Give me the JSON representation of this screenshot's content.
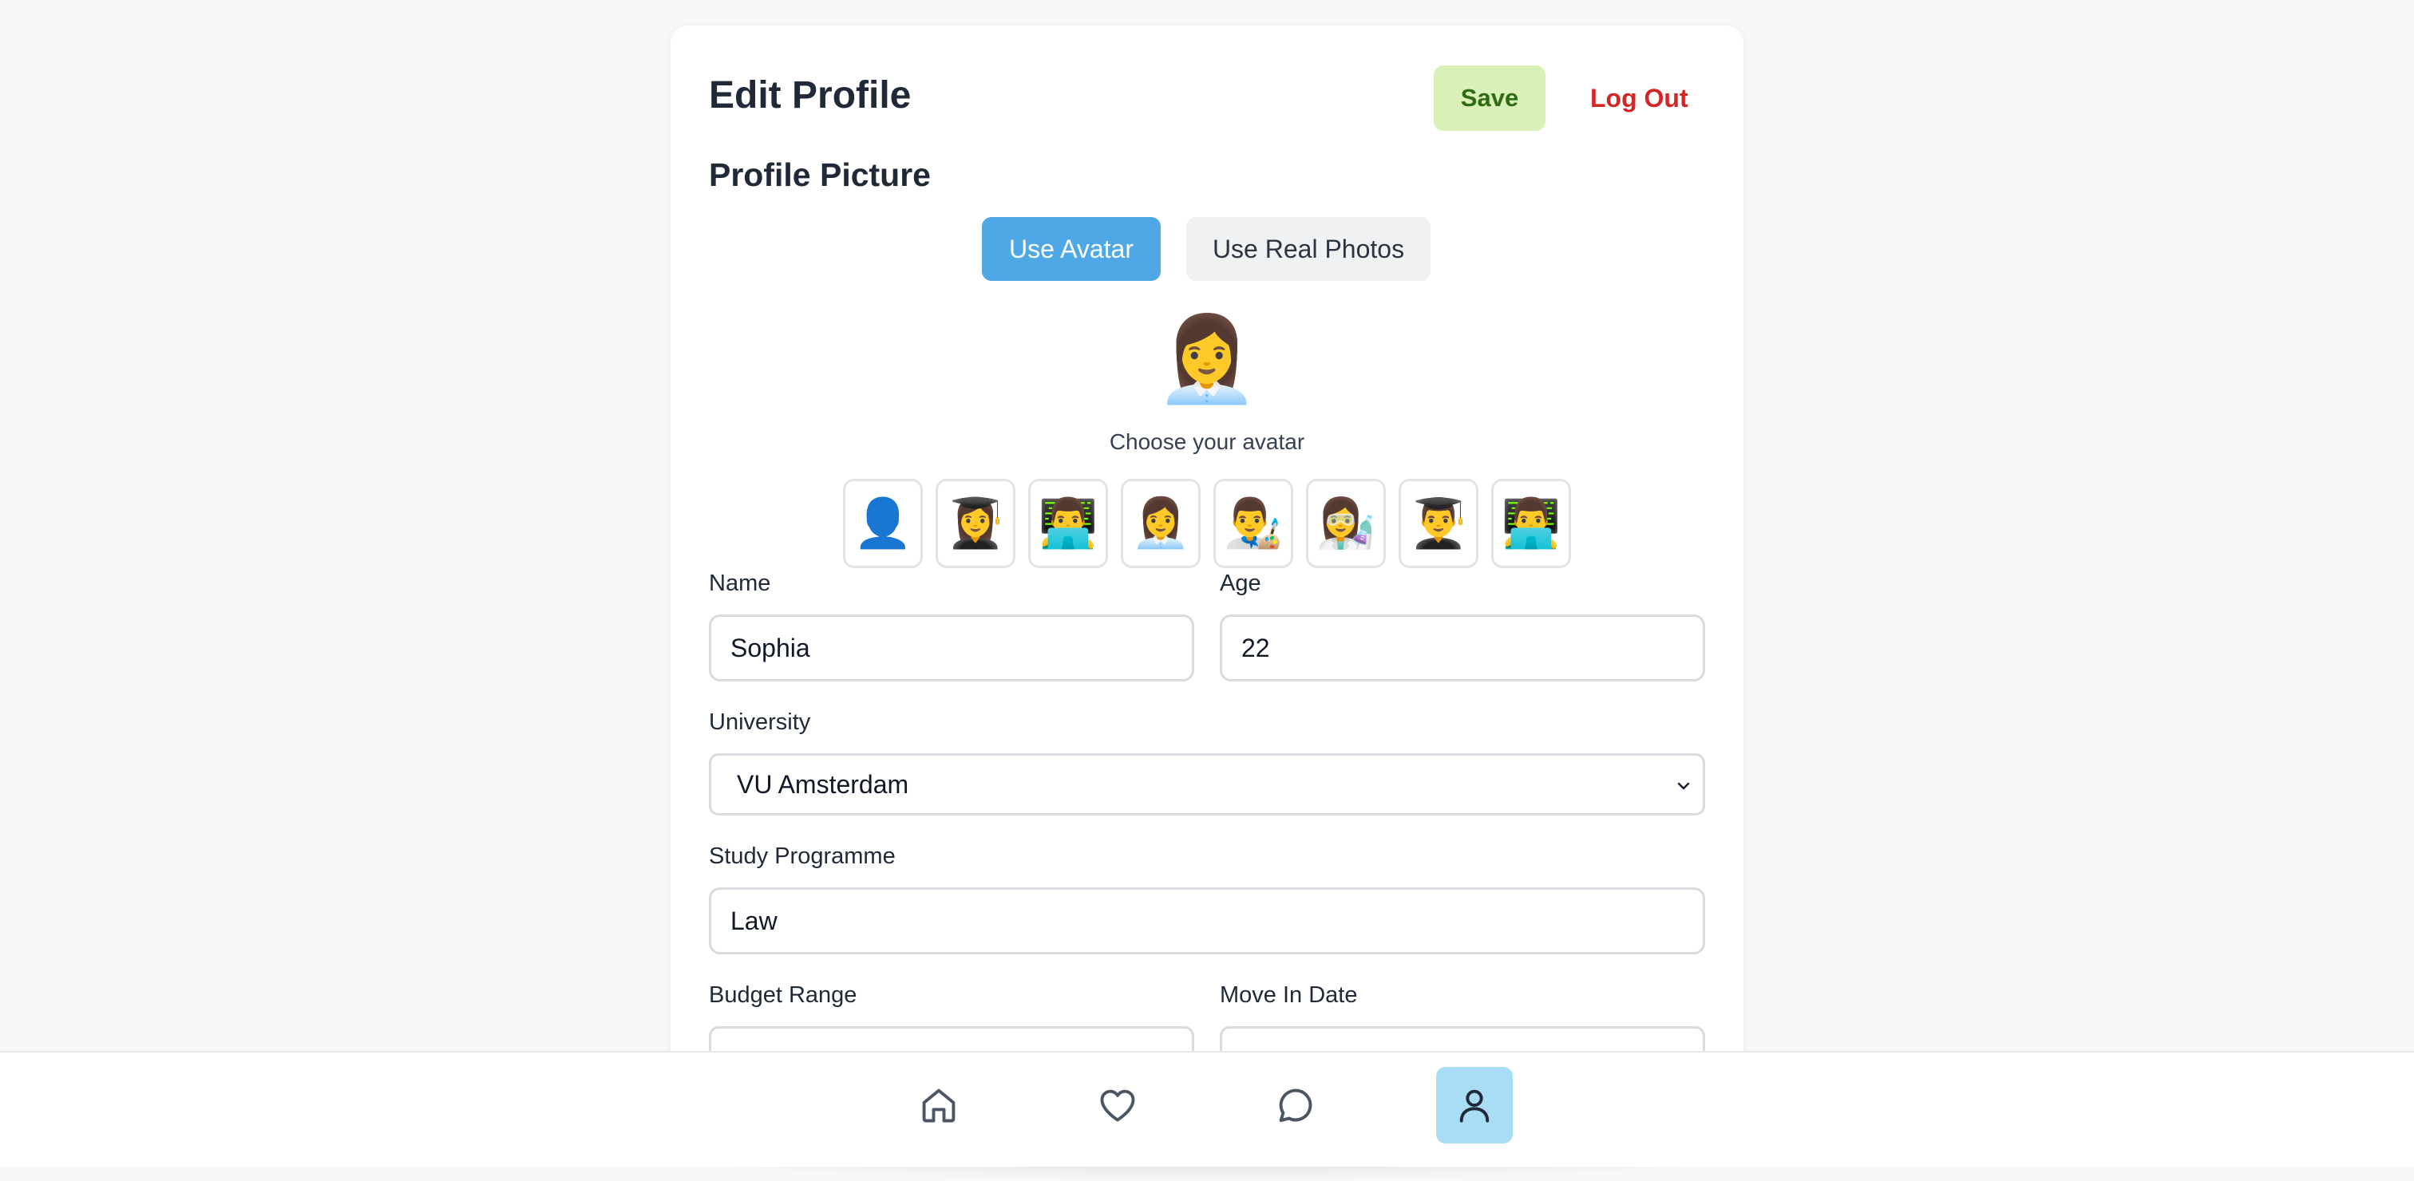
{
  "header": {
    "title": "Edit Profile",
    "save_label": "Save",
    "logout_label": "Log Out"
  },
  "profile_picture": {
    "title": "Profile Picture",
    "use_avatar_label": "Use Avatar",
    "use_photos_label": "Use Real Photos",
    "selected_avatar": "👩‍💼",
    "choose_label": "Choose your avatar",
    "options": [
      "👤",
      "👩‍🎓",
      "👨‍💻",
      "👩‍💼",
      "👨‍🎨",
      "👩‍🔬",
      "👨‍🎓",
      "👨‍💻"
    ]
  },
  "form": {
    "name": {
      "label": "Name",
      "value": "Sophia"
    },
    "age": {
      "label": "Age",
      "value": "22"
    },
    "university": {
      "label": "University",
      "value": "VU Amsterdam"
    },
    "study_programme": {
      "label": "Study Programme",
      "value": "Law"
    },
    "budget_range": {
      "label": "Budget Range"
    },
    "move_in_date": {
      "label": "Move In Date"
    }
  },
  "nav": {
    "items": [
      {
        "icon": "home-icon"
      },
      {
        "icon": "heart-icon"
      },
      {
        "icon": "chat-icon"
      },
      {
        "icon": "user-icon",
        "active": true
      }
    ]
  },
  "colors": {
    "accent": "#4ea8e6",
    "save_bg": "#d9f0b8",
    "save_text": "#2f6b12",
    "logout_text": "#d32626",
    "nav_active": "#a9dcf5"
  }
}
